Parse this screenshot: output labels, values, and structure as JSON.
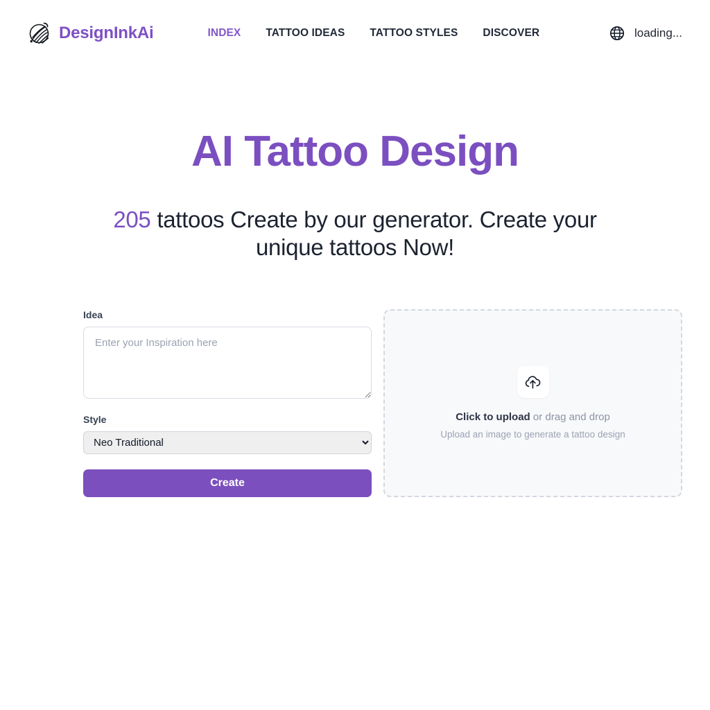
{
  "header": {
    "brand": {
      "name": "DesignInkAi",
      "icon": "tattoo-swirl-logo-icon"
    },
    "nav": [
      {
        "label": "INDEX",
        "active": true
      },
      {
        "label": "TATTOO IDEAS",
        "active": false
      },
      {
        "label": "TATTOO STYLES",
        "active": false
      },
      {
        "label": "DISCOVER",
        "active": false
      }
    ],
    "language": {
      "icon": "globe-icon",
      "label": "loading..."
    }
  },
  "hero": {
    "title": "AI Tattoo Design",
    "count": "205",
    "subtitle_rest": " tattoos Create by our generator. Create your unique tattoos Now!"
  },
  "generator": {
    "idea": {
      "label": "Idea",
      "placeholder": "Enter your Inspiration here",
      "value": ""
    },
    "style": {
      "label": "Style",
      "selected": "Neo Traditional",
      "options": [
        "Neo Traditional"
      ]
    },
    "submit_label": "Create"
  },
  "upload": {
    "icon": "cloud-upload-icon",
    "primary_strong": "Click to upload",
    "primary_rest": " or drag and drop",
    "secondary": "Upload an image to generate a tattoo design"
  },
  "colors": {
    "brand_purple": "#7b4fc0",
    "button_purple": "#7b4fbd",
    "nav_active": "#8457c9",
    "text_dark": "#1c2230",
    "muted": "#9aa2b1"
  }
}
